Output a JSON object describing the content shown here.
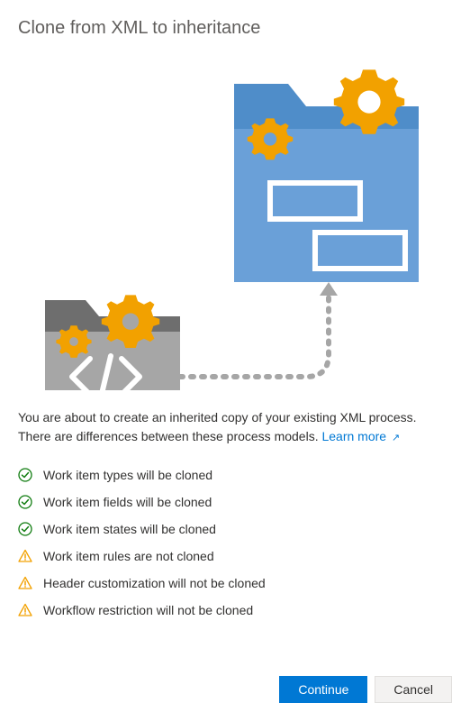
{
  "title": "Clone from XML to inheritance",
  "description": {
    "text": "You are about to create an inherited copy of your existing XML process. There are differences between these process models.",
    "link_label": "Learn more"
  },
  "items": [
    {
      "status": "ok",
      "text": "Work item types will be cloned"
    },
    {
      "status": "ok",
      "text": "Work item fields will be cloned"
    },
    {
      "status": "ok",
      "text": "Work item states will be cloned"
    },
    {
      "status": "warn",
      "text": "Work item rules are not cloned"
    },
    {
      "status": "warn",
      "text": "Header customization will not be cloned"
    },
    {
      "status": "warn",
      "text": "Workflow restriction will not be cloned"
    }
  ],
  "buttons": {
    "continue": "Continue",
    "cancel": "Cancel"
  },
  "colors": {
    "primary": "#0078d4",
    "success": "#107c10",
    "warning": "#f2a100"
  }
}
